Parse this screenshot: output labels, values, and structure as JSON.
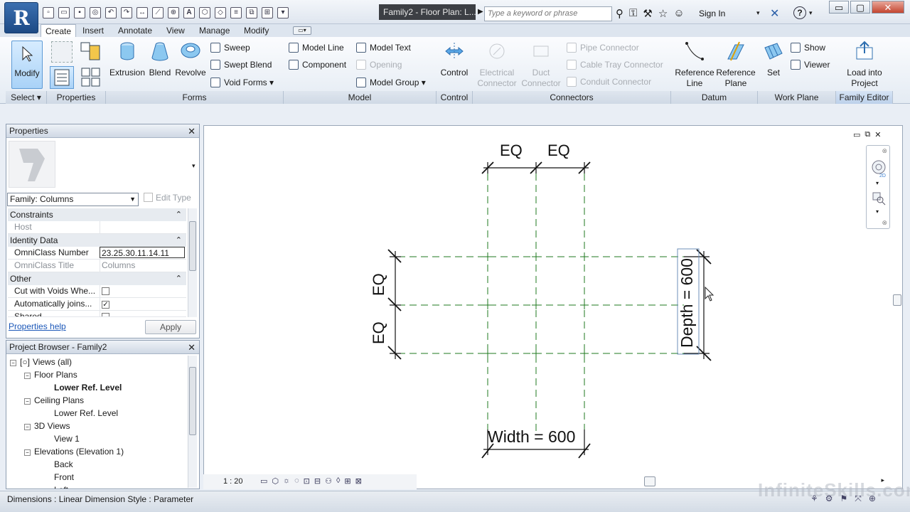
{
  "titlebar": {
    "app_letter": "R",
    "doc_title": "Family2 - Floor Plan: L...",
    "search_placeholder": "Type a keyword or phrase",
    "sign_in": "Sign In",
    "help": "?",
    "min": "▭",
    "restore": "▢",
    "close": "✕"
  },
  "tabs": [
    "Create",
    "Insert",
    "Annotate",
    "View",
    "Manage",
    "Modify"
  ],
  "ribbon": {
    "select": {
      "modify": "Modify",
      "label": "Select"
    },
    "properties": {
      "label": "Properties"
    },
    "forms": {
      "extrusion": "Extrusion",
      "blend": "Blend",
      "revolve": "Revolve",
      "sweep": "Sweep",
      "swept_blend": "Swept Blend",
      "void_forms": "Void Forms",
      "label": "Forms"
    },
    "model": {
      "model_line": "Model Line",
      "component": "Component",
      "model_text": "Model Text",
      "opening": "Opening",
      "model_group": "Model Group",
      "label": "Model"
    },
    "control": {
      "control": "Control",
      "label": "Control"
    },
    "connectors": {
      "electrical_1": "Electrical",
      "electrical_2": "Connector",
      "duct_1": "Duct",
      "duct_2": "Connector",
      "pipe": "Pipe Connector",
      "cable_tray": "Cable Tray Connector",
      "conduit": "Conduit Connector",
      "label": "Connectors"
    },
    "datum": {
      "ref_line_1": "Reference",
      "ref_line_2": "Line",
      "ref_plane_1": "Reference",
      "ref_plane_2": "Plane",
      "label": "Datum"
    },
    "work_plane": {
      "set": "Set",
      "show": "Show",
      "viewer": "Viewer",
      "label": "Work Plane"
    },
    "family_editor": {
      "load_1": "Load into",
      "load_2": "Project",
      "label": "Family Editor"
    }
  },
  "properties": {
    "title": "Properties",
    "type_selector": "Family: Columns",
    "edit_type": "Edit Type",
    "groups": {
      "constraints": "Constraints",
      "identity": "Identity Data",
      "other": "Other"
    },
    "rows": {
      "host_k": "Host",
      "host_v": "",
      "omni_num_k": "OmniClass Number",
      "omni_num_v": "23.25.30.11.14.11",
      "omni_title_k": "OmniClass Title",
      "omni_title_v": "Columns",
      "cut_voids_k": "Cut with Voids Whe...",
      "auto_joins_k": "Automatically joins...",
      "shared_k": "Shared"
    },
    "checks": {
      "cut_voids": "",
      "auto_joins": "✓",
      "shared": ""
    },
    "help": "Properties help",
    "apply": "Apply"
  },
  "browser": {
    "title": "Project Browser - Family2",
    "items": {
      "views_all": "Views (all)",
      "floor_plans": "Floor Plans",
      "lower_ref_fp": "Lower Ref. Level",
      "ceiling_plans": "Ceiling Plans",
      "lower_ref_cp": "Lower Ref. Level",
      "views_3d": "3D Views",
      "view1": "View 1",
      "elevations": "Elevations (Elevation 1)",
      "back": "Back",
      "front": "Front",
      "left": "Left"
    }
  },
  "drawing": {
    "eq_top_left": "EQ",
    "eq_top_right": "EQ",
    "eq_left_upper": "EQ",
    "eq_left_lower": "EQ",
    "width_label": "Width = 600",
    "depth_label": "Depth = 600"
  },
  "view_control": {
    "scale": "1 : 20"
  },
  "status": {
    "text": "Dimensions : Linear Dimension Style : Parameter"
  },
  "watermark": "InfiniteSkills.com",
  "colors": {
    "accent": "#1d4a85",
    "ref_plane": "#1f7a1f",
    "dimension": "#111111"
  }
}
